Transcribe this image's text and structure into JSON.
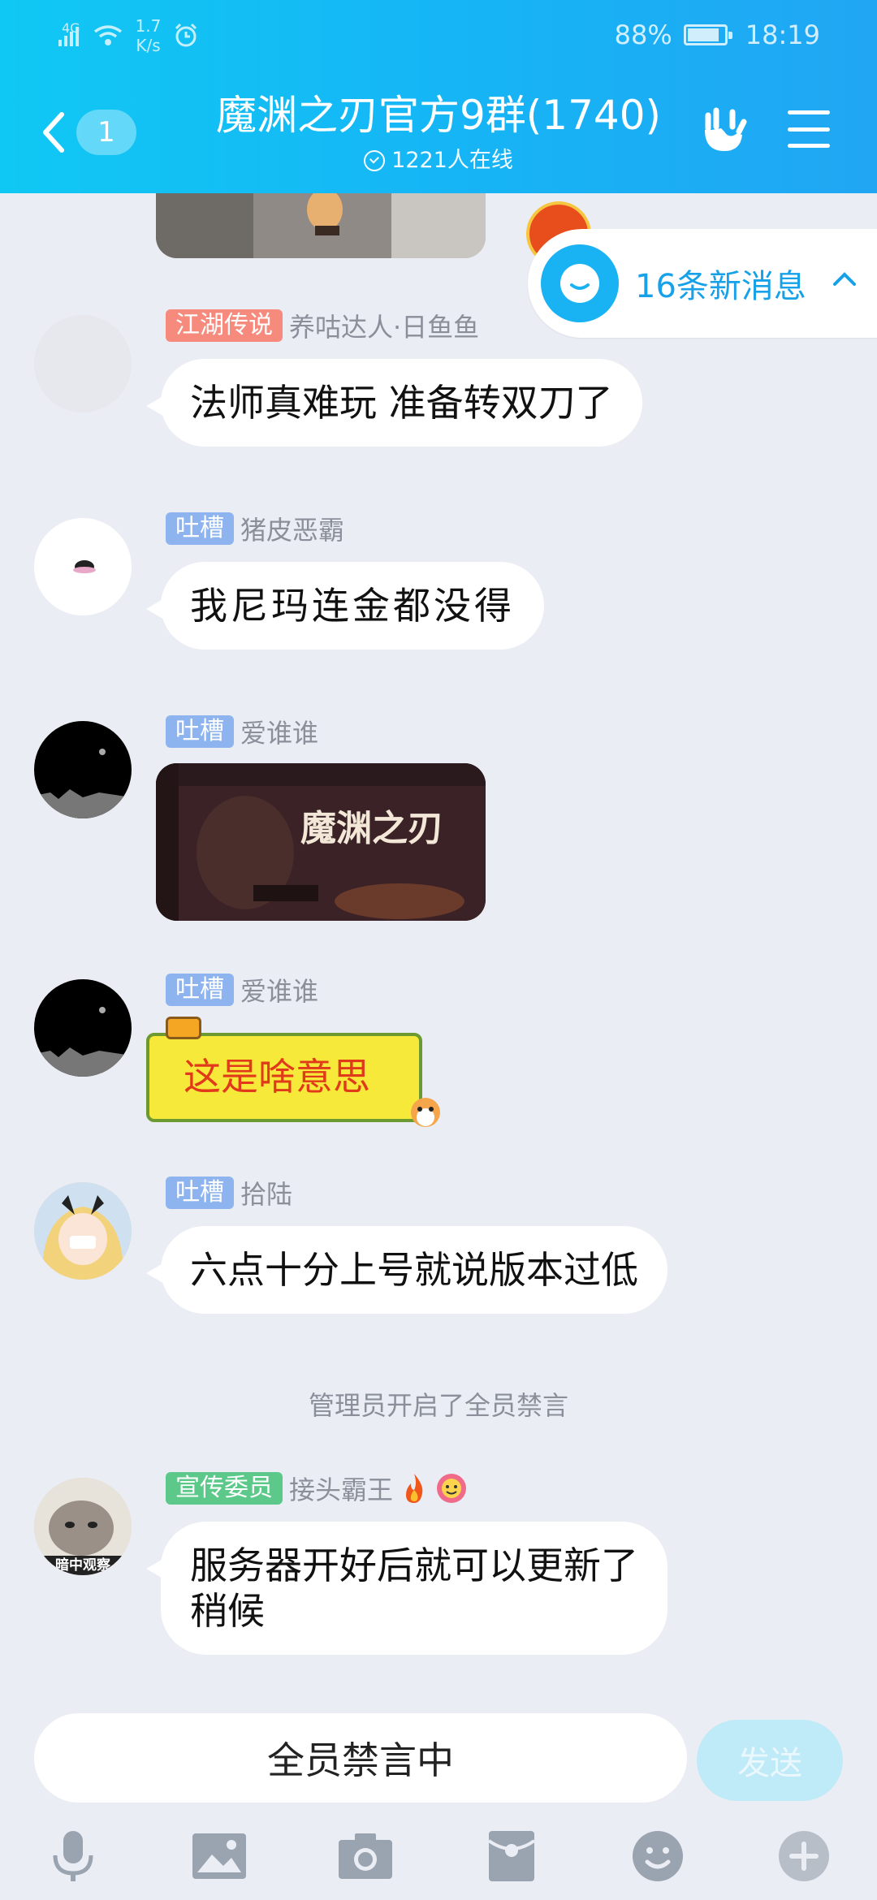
{
  "status_bar": {
    "network": "4G",
    "speed_value": "1.7",
    "speed_unit": "K/s",
    "battery": "88%",
    "battery_level": 0.88,
    "time": "18:19"
  },
  "header": {
    "back_count": "1",
    "title": "魔渊之刃官方9群(1740)",
    "online": "1221人在线"
  },
  "new_messages": {
    "label": "16条新消息"
  },
  "messages": [
    {
      "tag": "江湖传说",
      "tag_color": "#f58a7d",
      "name": "养咕达人·日鱼鱼",
      "text": "法师真难玩  准备转双刀了"
    },
    {
      "tag": "吐槽",
      "tag_color": "#8db4ee",
      "name": "猪皮恶霸",
      "text": "我尼玛连金都没得"
    },
    {
      "tag": "吐槽",
      "tag_color": "#8db4ee",
      "name": "爱谁谁",
      "image_caption": "魔渊之刃"
    },
    {
      "tag": "吐槽",
      "tag_color": "#8db4ee",
      "name": "爱谁谁",
      "sticker_text": "这是啥意思"
    },
    {
      "tag": "吐槽",
      "tag_color": "#8db4ee",
      "name": "拾陆",
      "text": "六点十分上号就说版本过低"
    },
    {
      "tag": "宣传委员",
      "tag_color": "#5cc98a",
      "name": "接头霸王",
      "text_line1": "服务器开好后就可以更新了",
      "text_line2": "稍候"
    }
  ],
  "system_notice": "管理员开启了全员禁言",
  "input": {
    "placeholder": "全员禁言中",
    "send_label": "发送"
  },
  "avatar_caption": "暗中观察",
  "toolbar": [
    "mic-icon",
    "image-icon",
    "camera-icon",
    "red-packet-icon",
    "emoji-icon",
    "plus-icon"
  ]
}
